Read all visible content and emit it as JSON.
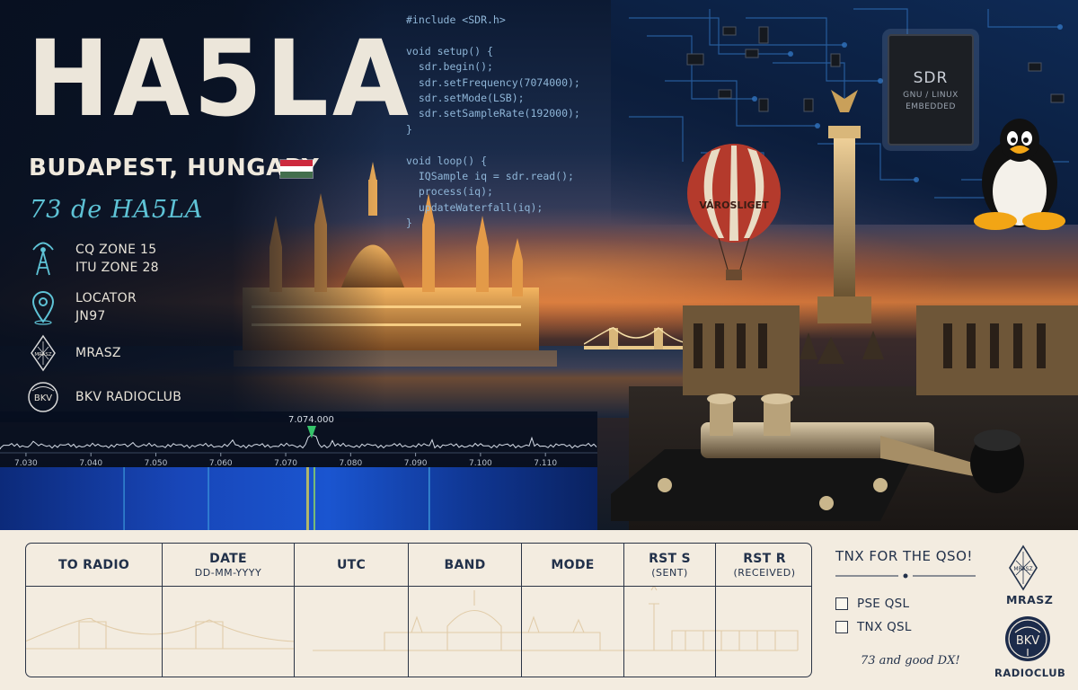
{
  "header": {
    "callsign": "HA5LA",
    "city": "BUDAPEST, HUNGARY",
    "greeting": "73 de HA5LA",
    "flag_colors": [
      "#cd2a3e",
      "#ffffff",
      "#436f4d"
    ]
  },
  "info": {
    "zones": {
      "icon": "antenna-tower-icon",
      "line1": "CQ ZONE 15",
      "line2": "ITU ZONE 28"
    },
    "locator": {
      "icon": "map-pin-icon",
      "line1": "LOCATOR",
      "line2": "JN97"
    },
    "mrasz": {
      "icon": "mrasz-diamond-icon",
      "line1": "MRASZ",
      "icon_text": "MRASZ"
    },
    "bkv": {
      "icon": "bkv-circle-icon",
      "line1": "BKV RADIOCLUB",
      "icon_text": "BKV"
    }
  },
  "code": {
    "lines": [
      "#include <SDR.h>",
      "",
      "void setup() {",
      "  sdr.begin();",
      "  sdr.setFrequency(7074000);",
      "  sdr.setMode(LSB);",
      "  sdr.setSampleRate(192000);",
      "}",
      "",
      "void loop() {",
      "  IQSample iq = sdr.read();",
      "  process(iq);",
      "  updateWaterfall(iq);",
      "}"
    ]
  },
  "chip": {
    "title": "SDR",
    "line1": "GNU / LINUX",
    "line2": "EMBEDDED"
  },
  "balloon": {
    "text": "VÁROSLIGET"
  },
  "spectrum": {
    "marker_label": "7.074.000",
    "marker_value": 7.074,
    "range": [
      7.026,
      7.118
    ],
    "ticks": [
      "7.030",
      "7.040",
      "7.050",
      "7.060",
      "7.070",
      "7.080",
      "7.090",
      "7.100",
      "7.110"
    ],
    "tick_values": [
      7.03,
      7.04,
      7.05,
      7.06,
      7.07,
      7.08,
      7.09,
      7.1,
      7.11
    ]
  },
  "qso_table": {
    "columns": [
      {
        "label": "TO RADIO",
        "sub": ""
      },
      {
        "label": "DATE",
        "sub": "DD-MM-YYYY"
      },
      {
        "label": "UTC",
        "sub": ""
      },
      {
        "label": "BAND",
        "sub": ""
      },
      {
        "label": "MODE",
        "sub": ""
      },
      {
        "label": "RST S",
        "sub": "(SENT)"
      },
      {
        "label": "RST R",
        "sub": "(RECEIVED)"
      }
    ]
  },
  "confirm": {
    "title": "TNX FOR THE QSO!",
    "options": [
      "PSE QSL",
      "TNX QSL"
    ],
    "signoff": "73 and good DX!"
  },
  "logos": {
    "mrasz": {
      "label": "MRASZ",
      "icon_text": "MRASZ"
    },
    "bkv": {
      "label": "RADIOCLUB",
      "icon_text": "BKV"
    }
  },
  "colors": {
    "accent_teal": "#5ec3d6",
    "cream": "#f3ece0",
    "navy": "#22314a",
    "gold": "#e8a24a"
  }
}
